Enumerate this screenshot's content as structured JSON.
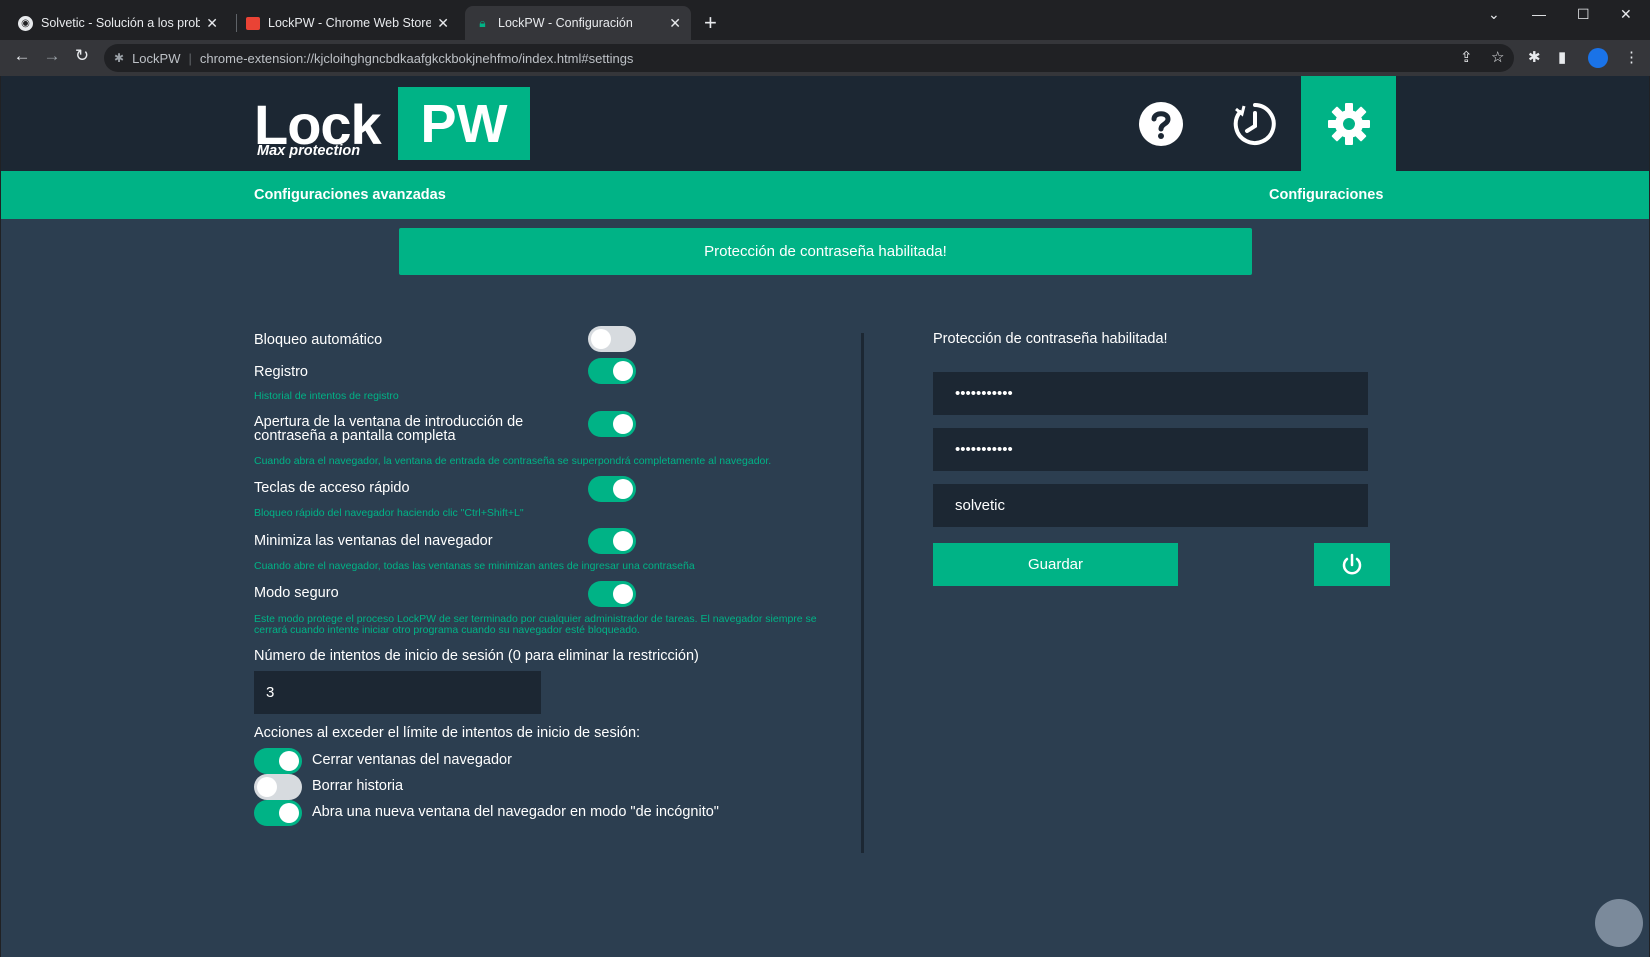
{
  "browser": {
    "tabs": [
      {
        "title": "Solvetic - Solución a los problem",
        "active": false,
        "favicon": "globe-icon"
      },
      {
        "title": "LockPW - Chrome Web Store",
        "active": false,
        "favicon": "webstore-icon"
      },
      {
        "title": "LockPW - Configuración",
        "active": true,
        "favicon": "lock-icon"
      }
    ],
    "address": {
      "extension_name": "LockPW",
      "url": "chrome-extension://kjcloihghgncbdkaafgkckbokjnehfmo/index.html#settings"
    }
  },
  "app": {
    "logo": {
      "word": "Lock",
      "badge": "PW",
      "tagline": "Max protection"
    },
    "header_icons": [
      "help-icon",
      "history-icon",
      "settings-icon"
    ],
    "subnav": {
      "left": "Configuraciones avanzadas",
      "right": "Configuraciones"
    },
    "banner": "Protección de contraseña habilitada!",
    "settings": [
      {
        "label": "Bloqueo automático",
        "hint": "",
        "enabled": false
      },
      {
        "label": "Registro",
        "hint": "Historial de intentos de registro",
        "enabled": true
      },
      {
        "label": "Apertura de la ventana de introducción de contraseña a pantalla completa",
        "hint": "Cuando abra el navegador, la ventana de entrada de contraseña se superpondrá completamente al navegador.",
        "enabled": true
      },
      {
        "label": "Teclas de acceso rápido",
        "hint": "Bloqueo rápido del navegador haciendo clic \"Ctrl+Shift+L\"",
        "enabled": true
      },
      {
        "label": "Minimiza las ventanas del navegador",
        "hint": "Cuando abre el navegador, todas las ventanas se minimizan antes de ingresar una contraseña",
        "enabled": true
      },
      {
        "label": "Modo seguro",
        "hint": "Este modo protege el proceso LockPW de ser terminado por cualquier administrador de tareas. El navegador siempre se cerrará cuando intente iniciar otro programa cuando su navegador esté bloqueado.",
        "enabled": true
      }
    ],
    "attempts": {
      "label": "Número de intentos de inicio de sesión (0 para eliminar la restricción)",
      "value": "3"
    },
    "actions": {
      "label": "Acciones al exceder el límite de intentos de inicio de sesión:",
      "items": [
        {
          "label": "Cerrar ventanas del navegador",
          "enabled": true
        },
        {
          "label": "Borrar historia",
          "enabled": false
        },
        {
          "label": "Abra una nueva ventana del navegador en modo \"de incógnito\"",
          "enabled": true
        }
      ]
    },
    "password_panel": {
      "title": "Protección de contraseña habilitada!",
      "password_mask": "•••••••••••",
      "confirm_mask": "•••••••••••",
      "hint_value": "solvetic",
      "save_label": "Guardar"
    },
    "colors": {
      "accent": "#00b386",
      "panel": "#2c3e50",
      "header": "#1c2733"
    }
  }
}
